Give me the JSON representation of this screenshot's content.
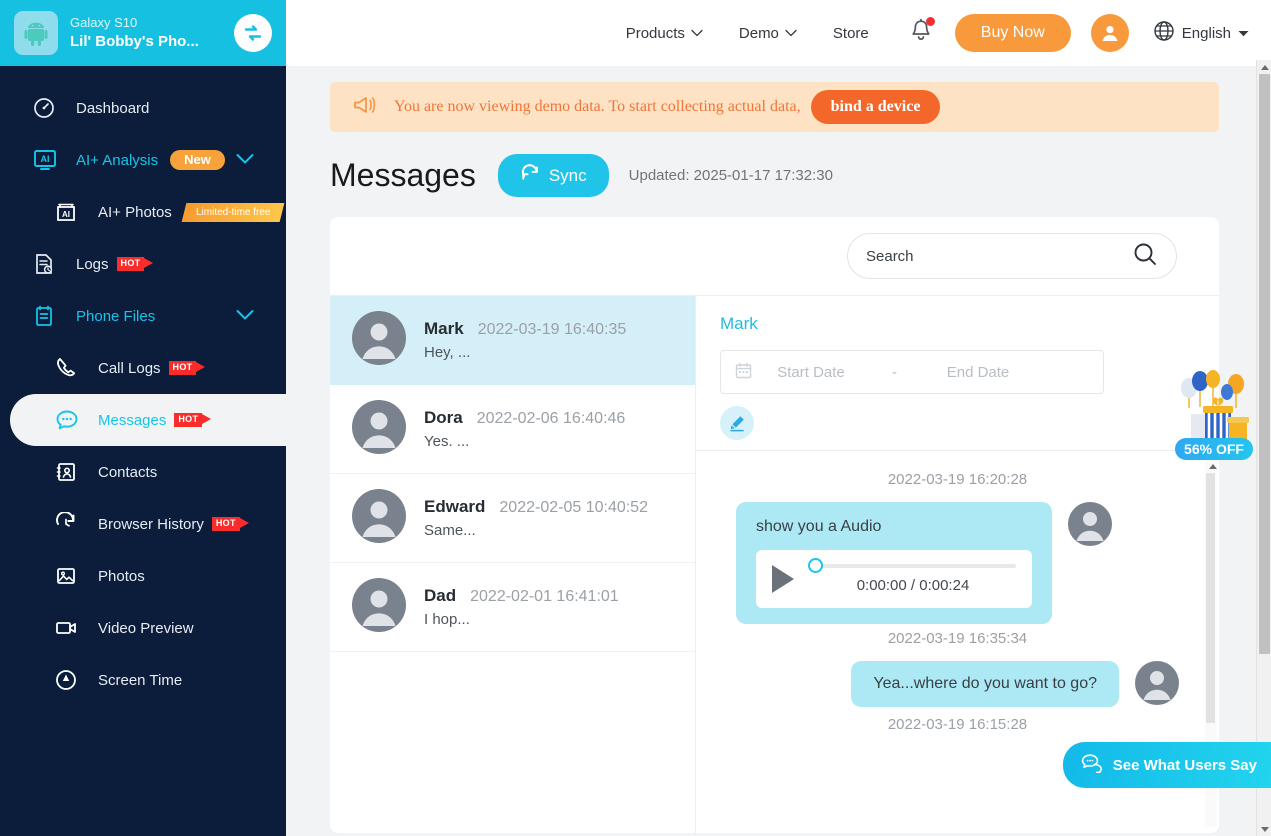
{
  "sidebar": {
    "device": {
      "model": "Galaxy S10",
      "name": "Lil' Bobby's Pho...",
      "icon": "android-icon",
      "switch_icon": "switch-device-icon"
    },
    "items": [
      {
        "label": "Dashboard",
        "icon": "speedometer-icon",
        "badge": "",
        "type": "top"
      },
      {
        "label": "AI+ Analysis",
        "icon": "ai-monitor-icon",
        "badge": "New",
        "type": "top"
      },
      {
        "label": "AI+ Photos",
        "icon": "ai-box-icon",
        "badge": "Limited-time free",
        "type": "sub"
      },
      {
        "label": "Logs",
        "icon": "log-file-icon",
        "badge": "HOT",
        "type": "top"
      },
      {
        "label": "Phone Files",
        "icon": "clipboard-icon",
        "badge": "",
        "type": "top"
      },
      {
        "label": "Call Logs",
        "icon": "phone-icon",
        "badge": "HOT",
        "type": "sub"
      },
      {
        "label": "Messages",
        "icon": "chat-bubble-icon",
        "badge": "HOT",
        "type": "sub"
      },
      {
        "label": "Contacts",
        "icon": "contact-card-icon",
        "badge": "",
        "type": "sub"
      },
      {
        "label": "Browser History",
        "icon": "history-clock-icon",
        "badge": "HOT",
        "type": "sub"
      },
      {
        "label": "Photos",
        "icon": "image-icon",
        "badge": "",
        "type": "sub"
      },
      {
        "label": "Video Preview",
        "icon": "video-camera-icon",
        "badge": "",
        "type": "sub"
      },
      {
        "label": "Screen Time",
        "icon": "screen-time-icon",
        "badge": "",
        "type": "sub"
      }
    ],
    "active_item": "Messages"
  },
  "topbar": {
    "nav": [
      {
        "label": "Products",
        "has_caret": true
      },
      {
        "label": "Demo",
        "has_caret": true
      },
      {
        "label": "Store",
        "has_caret": false
      }
    ],
    "buy_now": "Buy Now",
    "language": "English",
    "notification_icon": "bell-icon",
    "account_icon": "user-avatar-icon",
    "globe_icon": "globe-icon"
  },
  "notice": {
    "icon": "megaphone-icon",
    "text": "You are now viewing demo data. To start collecting actual data,",
    "button": "bind a device"
  },
  "page": {
    "title": "Messages",
    "sync_label": "Sync",
    "sync_icon": "refresh-icon",
    "updated": "Updated: 2025-01-17 17:32:30"
  },
  "search": {
    "placeholder": "Search",
    "value": "",
    "icon": "search-icon"
  },
  "threads": [
    {
      "name": "Mark",
      "time": "2022-03-19 16:40:35",
      "preview": "Hey, ...",
      "selected": true
    },
    {
      "name": "Dora",
      "time": "2022-02-06 16:40:46",
      "preview": "Yes. ...",
      "selected": false
    },
    {
      "name": "Edward",
      "time": "2022-02-05 10:40:52",
      "preview": "Same...",
      "selected": false
    },
    {
      "name": "Dad",
      "time": "2022-02-01 16:41:01",
      "preview": "I hop...",
      "selected": false
    }
  ],
  "chat": {
    "contact_name": "Mark",
    "date_filter": {
      "icon": "calendar-icon",
      "start_placeholder": "Start Date",
      "start_value": "",
      "separator": "-",
      "end_placeholder": "End Date",
      "end_value": ""
    },
    "edit_icon": "pencil-edit-icon",
    "messages": [
      {
        "timestamp": "2022-03-19 16:20:28",
        "direction": "incoming",
        "text": "show you a Audio",
        "attachment": {
          "type": "audio",
          "play_icon": "play-icon",
          "time": "0:00:00 / 0:00:24",
          "progress": 0
        }
      },
      {
        "timestamp": "2022-03-19 16:35:34",
        "direction": "outgoing",
        "text": "Yea...where do you want to go?"
      },
      {
        "timestamp": "2022-03-19 16:15:28",
        "direction": "none",
        "text": ""
      }
    ]
  },
  "floating": {
    "promo": {
      "badge": "56% OFF",
      "icon": "gift-balloons-icon"
    },
    "users_say": {
      "label": "See What Users Say",
      "icon": "chat-quote-icon"
    }
  },
  "colors": {
    "sidebar_bg": "#0b1d3a",
    "accent_cyan": "#1fc4e8",
    "accent_orange": "#f89a3c",
    "notice_bg": "#fde3c4",
    "notice_text": "#f1753a",
    "bubble_bg": "#ace9f5",
    "selected_row": "#d5eff8",
    "hot_red": "#fa2b2b"
  }
}
